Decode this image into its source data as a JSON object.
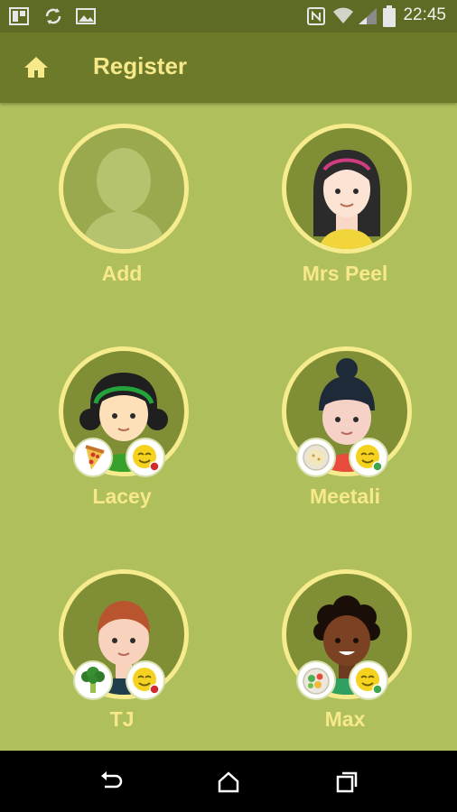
{
  "status_bar": {
    "time": "22:45",
    "icons": [
      "tablet-icon",
      "sync-icon",
      "image-icon",
      "nfc-icon",
      "wifi-icon",
      "signal-icon",
      "battery-icon"
    ]
  },
  "app_bar": {
    "title": "Register",
    "home_icon": "home-icon"
  },
  "people": [
    {
      "name": "Add",
      "type": "add"
    },
    {
      "name": "Mrs Peel",
      "type": "person"
    },
    {
      "name": "Lacey",
      "type": "person",
      "food_badge": "pizza-icon",
      "mood_badge": "happy-face-icon",
      "mood_status": "red"
    },
    {
      "name": "Meetali",
      "type": "person",
      "food_badge": "plate-icon",
      "mood_badge": "happy-face-icon",
      "mood_status": "green"
    },
    {
      "name": "TJ",
      "type": "person",
      "food_badge": "broccoli-icon",
      "mood_badge": "happy-face-icon",
      "mood_status": "red"
    },
    {
      "name": "Max",
      "type": "person",
      "food_badge": "salad-icon",
      "mood_badge": "happy-face-icon",
      "mood_status": "green"
    }
  ],
  "colors": {
    "background": "#afbf5c",
    "app_bar": "#6c7a2a",
    "status_bar": "#5e6b25",
    "accent_text": "#f7e98a",
    "avatar_ring": "#f7ec8d"
  },
  "nav_bar": [
    "back-icon",
    "home-nav-icon",
    "recents-icon"
  ]
}
